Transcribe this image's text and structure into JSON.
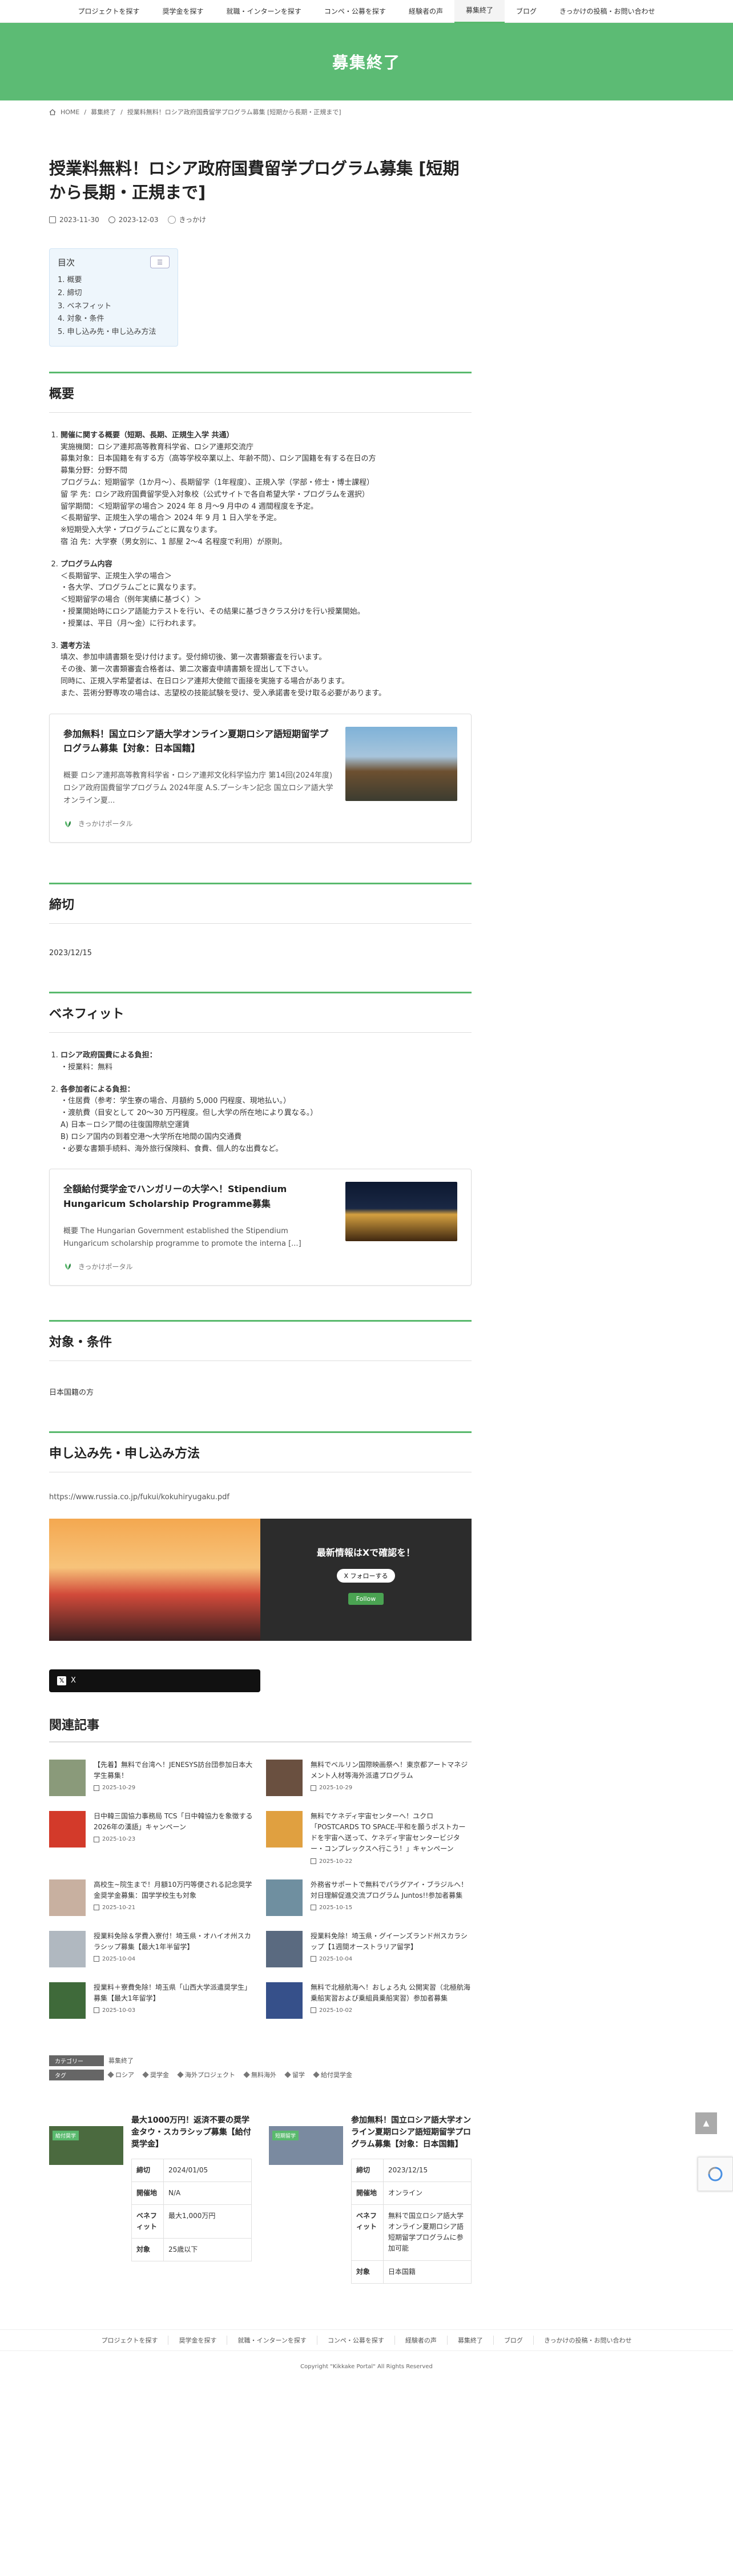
{
  "nav": [
    "プロジェクトを探す",
    "奨学金を探す",
    "就職・インターンを探す",
    "コンペ・公募を探す",
    "経験者の声",
    "募集終了",
    "ブログ",
    "きっかけの投稿・お問い合わせ"
  ],
  "nav_active_index": 5,
  "hero_title": "募集終了",
  "breadcrumb": {
    "home": "HOME",
    "cat": "募集終了",
    "current": "授業料無料！ロシア政府国費留学プログラム募集 [短期から長期・正規まで]"
  },
  "post": {
    "title": "授業料無料！ロシア政府国費留学プログラム募集 [短期から長期・正規まで]",
    "published": "2023-11-30",
    "updated": "2023-12-03",
    "author": "きっかけ"
  },
  "toc": {
    "title": "目次",
    "toggle": "☰",
    "items": [
      "1. 概要",
      "2. 締切",
      "3. ベネフィット",
      "4. 対象・条件",
      "5. 申し込み先・申し込み方法"
    ]
  },
  "sections": {
    "overview": "概要",
    "deadline": "締切",
    "benefit": "ベネフィット",
    "eligibility": "対象・条件",
    "apply": "申し込み先・申し込み方法"
  },
  "overview_items": [
    {
      "lead": "開催に関する概要（短期、長期、正規生入学 共通）",
      "lines": [
        "実施機関：ロシア連邦高等教育科学省、ロシア連邦交流庁",
        "募集対象：日本国籍を有する方（高等学校卒業以上、年齢不問）、ロシア国籍を有する在日の方",
        "募集分野：分野不問",
        "プログラム：短期留学（1か月〜）、長期留学（1年程度）、正規入学（学部・修士・博士課程）",
        "留 学 先：ロシア政府国費留学受入対象校（公式サイトで各自希望大学・プログラムを選択）",
        "留学期間：＜短期留学の場合＞ 2024 年 8 月〜9 月中の 4 週間程度を予定。",
        "＜長期留学、正規生入学の場合＞ 2024 年 9 月 1 日入学を予定。",
        "※短期受入大学・プログラムごとに異なります。",
        "宿 泊 先：大学寮（男女別に、1 部屋 2〜4 名程度で利用）が原則。"
      ]
    },
    {
      "lead": "プログラム内容",
      "lines": [
        "＜長期留学、正規生入学の場合＞",
        "・各大学、プログラムごとに異なります。",
        "＜短期留学の場合（例年実績に基づく）＞",
        "・授業開始時にロシア語能力テストを行い、その結果に基づきクラス分けを行い授業開始。",
        "・授業は、平日（月〜金）に行われます。"
      ]
    },
    {
      "lead": "選考方法",
      "lines": [
        "填次、参加申請書類を受け付けます。受付締切後、第一次書類審査を行います。",
        "その後、第一次書類審査合格者は、第二次審査申請書類を提出して下さい。",
        "同時に、正規入学希望者は、在日ロシア連邦大使館で面接を実施する場合があります。",
        "また、芸術分野専攻の場合は、志望校の技能試験を受け、受入承諾書を受け取る必要があります。"
      ]
    }
  ],
  "card1": {
    "title": "参加無料！国立ロシア語大学オンライン夏期ロシア語短期留学プログラム募集【対象：日本国籍】",
    "desc": "概要 ロシア連邦高等教育科学省・ロシア連邦文化科学協力庁 第14回(2024年度)ロシア政府国費留学プログラム 2024年度 A.S.プーシキン記念 国立ロシア語大学 オンライン夏...",
    "source": "きっかけポータル"
  },
  "deadline_value": "2023/12/15",
  "benefit_items": [
    {
      "lead": "ロシア政府国費による負担：",
      "lines": [
        "・授業料：無料"
      ]
    },
    {
      "lead": "各参加者による負担：",
      "lines": [
        "・住居費（参考：学生寮の場合、月額約 5,000 円程度、現地払い。）",
        "・渡航費（目安として 20〜30 万円程度。但し大学の所在地により異なる。）",
        "A) 日本－ロシア間の往復国際航空運賃",
        "B) ロシア国内の到着空港〜大学所在地間の国内交通費",
        "・必要な書類手続料、海外旅行保険料、食費、個人的な出費など。"
      ]
    }
  ],
  "card2": {
    "title": "全額給付奨学金でハンガリーの大学へ！Stipendium Hungaricum Scholarship Programme募集",
    "desc": "概要 The Hungarian Government established the Stipendium Hungaricum scholarship programme to promote the interna [...]",
    "source": "きっかけポータル"
  },
  "eligibility_value": "日本国籍の方",
  "apply_url": "https://www.russia.co.jp/fukui/kokuhiryugaku.pdf",
  "x_banner": {
    "title": "最新情報はXで確認を！",
    "x_follow": "X フォローする",
    "follow": "Follow"
  },
  "x_button_label": "X",
  "related": {
    "title": "関連記事",
    "items": [
      {
        "title": "【先着】無料で台湾へ！JENESYS訪台団参加日本大学生募集！",
        "date": "2025-10-29",
        "color": "#8a9a7a"
      },
      {
        "title": "無料でベルリン国際映画祭へ！東京都アートマネジメント人材等海外派遣プログラム",
        "date": "2025-10-29",
        "color": "#6a5040"
      },
      {
        "title": "日中韓三国協力事務局 TCS「日中韓協力を象徴する2026年の漢語」キャンペーン",
        "date": "2025-10-23",
        "color": "#d33a2a"
      },
      {
        "title": "無料でケネディ宇宙センターへ！ユクロ「POSTCARDS TO SPACE-平和を願うポストカードを宇宙へ送って、ケネディ宇宙センタービジター・コンプレックスへ行こう！」キャンペーン",
        "date": "2025-10-22",
        "color": "#e0a040"
      },
      {
        "title": "高校生~院生まで！月額10万円等便される記念奨学金奨学金募集：国学学校生も対象",
        "date": "2025-10-21",
        "color": "#c8b0a0"
      },
      {
        "title": "外務省サポートで無料でパラグアイ・ブラジルへ！対日理解促進交流プログラム Juntos!!参加者募集",
        "date": "2025-10-15",
        "color": "#6f8fa0"
      },
      {
        "title": "授業料免除＆学費入寮付！埼玉県・オハイオ州スカラシップ募集【最大1年半留学】",
        "date": "2025-10-04",
        "color": "#b0b8c0"
      },
      {
        "title": "授業料免除！埼玉県・グイーンズランド州スカラシップ【1週間オーストラリア留学】",
        "date": "2025-10-04",
        "color": "#5a6a80"
      },
      {
        "title": "授業料＋寮費免除！埼玉県「山西大学派遣奨学生」募集【最大1年留学】",
        "date": "2025-10-03",
        "color": "#3f6a3a"
      },
      {
        "title": "無料で北極航海へ！おしょろ丸 公開実習（北極航海乗船実習および乗組員乗船実習）参加者募集",
        "date": "2025-10-02",
        "color": "#36508a"
      }
    ]
  },
  "taxonomy": {
    "category_label": "カテゴリー",
    "category": "募集終了",
    "tag_label": "タグ",
    "tags": [
      "ロシア",
      "奨学金",
      "海外プロジェクト",
      "無料海外",
      "留学",
      "給付奨学金"
    ]
  },
  "pr": [
    {
      "img_label": "給付奨学",
      "title": "最大1000万円！返済不要の奨学金タウ・スカラシップ募集【給付奨学金】",
      "rows": [
        [
          "締切",
          "2024/01/05"
        ],
        [
          "開催地",
          "N/A"
        ],
        [
          "ベネフィット",
          "最大1,000万円"
        ],
        [
          "対象",
          "25歳以下"
        ]
      ]
    },
    {
      "img_label": "短期留学",
      "title": "参加無料！国立ロシア語大学オンライン夏期ロシア語短期留学プログラム募集【対象：日本国籍】",
      "rows": [
        [
          "締切",
          "2023/12/15"
        ],
        [
          "開催地",
          "オンライン"
        ],
        [
          "ベネフィット",
          "無料で国立ロシア語大学オンライン夏期ロシア語短期留学プログラムに参加可能"
        ],
        [
          "対象",
          "日本国籍"
        ]
      ]
    }
  ],
  "footer_nav": [
    "プロジェクトを探す",
    "奨学金を探す",
    "就職・インターンを探す",
    "コンペ・公募を探す",
    "経験者の声",
    "募集終了",
    "ブログ",
    "きっかけの投稿・お問い合わせ"
  ],
  "copyright": "Copyright \"Kikkake Portal\" All Rights Reserved",
  "colors": {
    "accent": "#5cbb74",
    "dark_panel": "#2c2c2c"
  }
}
